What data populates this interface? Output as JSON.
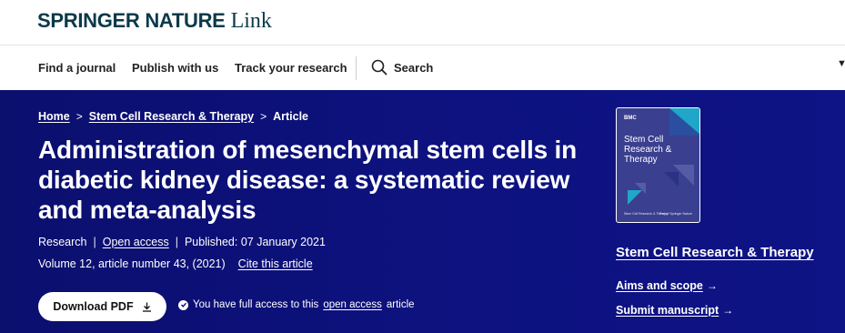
{
  "brand": {
    "name": "SPRINGER NATURE",
    "product": "Link"
  },
  "nav": {
    "items": [
      "Find a journal",
      "Publish with us",
      "Track your research"
    ],
    "search_label": "Search"
  },
  "breadcrumb": {
    "home": "Home",
    "journal": "Stem Cell Research & Therapy",
    "current": "Article",
    "separator": ">"
  },
  "article": {
    "title": "Administration of mesenchymal stem cells in diabetic kidney disease: a systematic review and meta-analysis",
    "type": "Research",
    "access": "Open access",
    "published": "Published: 07 January 2021",
    "volume": "Volume 12, article number 43, (2021)",
    "cite": "Cite this article"
  },
  "actions": {
    "download": "Download PDF",
    "access_prefix": "You have full access to this",
    "access_link": "open access",
    "access_suffix": "article"
  },
  "cover": {
    "publisher": "BMC",
    "title": "Stem Cell Research & Therapy",
    "footer_left": "Stem Cell Research & Therapy",
    "footer_right": "Part of Springer Nature"
  },
  "journal": {
    "name": "Stem Cell Research & Therapy",
    "aims": "Aims and scope",
    "submit": "Submit manuscript",
    "arrow": "→"
  },
  "colors": {
    "hero_bg": "#0c0e7a",
    "brand_text": "#0a3a4a",
    "cover_accent": "#1fa6c8"
  }
}
